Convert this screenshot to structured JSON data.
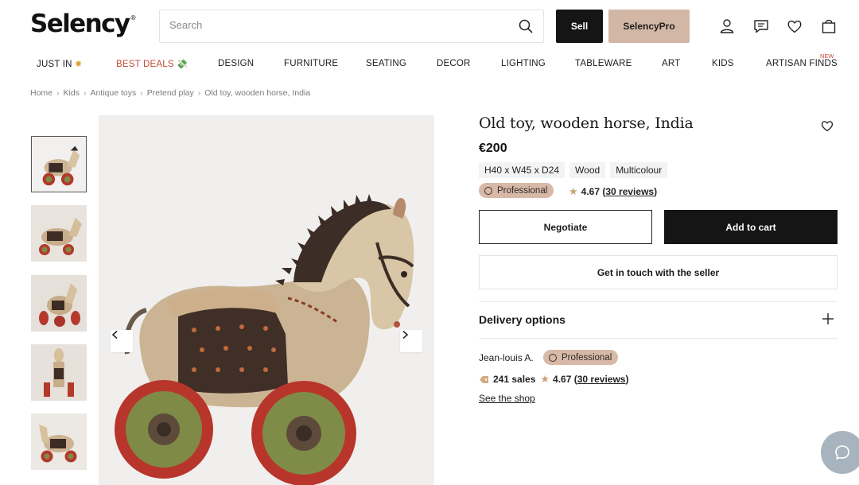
{
  "header": {
    "logo": "Selency",
    "logo_mark": "®",
    "search_placeholder": "Search",
    "sell_label": "Sell",
    "pro_label": "SelencyPro"
  },
  "nav": {
    "items": [
      "JUST IN",
      "BEST DEALS",
      "DESIGN",
      "FURNITURE",
      "SEATING",
      "DECOR",
      "LIGHTING",
      "TABLEWARE",
      "ART",
      "KIDS",
      "ARTISAN FINDS"
    ],
    "new_badge": "NEW",
    "just_in_emoji": "✸",
    "best_deals_emoji": "💸"
  },
  "breadcrumb": [
    "Home",
    "Kids",
    "Antique toys",
    "Pretend play",
    "Old toy, wooden horse, India"
  ],
  "product": {
    "title": "Old toy, wooden horse, India",
    "price": "€200",
    "tags": [
      "H40 x W45 x D24",
      "Wood",
      "Multicolour"
    ],
    "badge": "Professional",
    "rating": "4.67",
    "reviews": "30 reviews",
    "negotiate_label": "Negotiate",
    "add_to_cart_label": "Add to cart",
    "contact_label": "Get in touch with the seller",
    "delivery_label": "Delivery options"
  },
  "seller": {
    "name": "Jean-louis A.",
    "badge": "Professional",
    "sales": "241 sales",
    "rating": "4.67",
    "reviews": "30 reviews",
    "shop_link": "See the shop"
  },
  "colors": {
    "brand_dark": "#151515",
    "pro_beige": "#d3b7a6",
    "deals_red": "#c24a33",
    "badge_pink": "#d8b8a6",
    "star": "#c9a27d",
    "chat": "#a7b4bd"
  },
  "icons": [
    "search-icon",
    "user-icon",
    "message-icon",
    "heart-icon",
    "bag-icon",
    "chevron-left-icon",
    "chevron-right-icon",
    "plus-icon",
    "tag-icon",
    "chat-icon"
  ]
}
